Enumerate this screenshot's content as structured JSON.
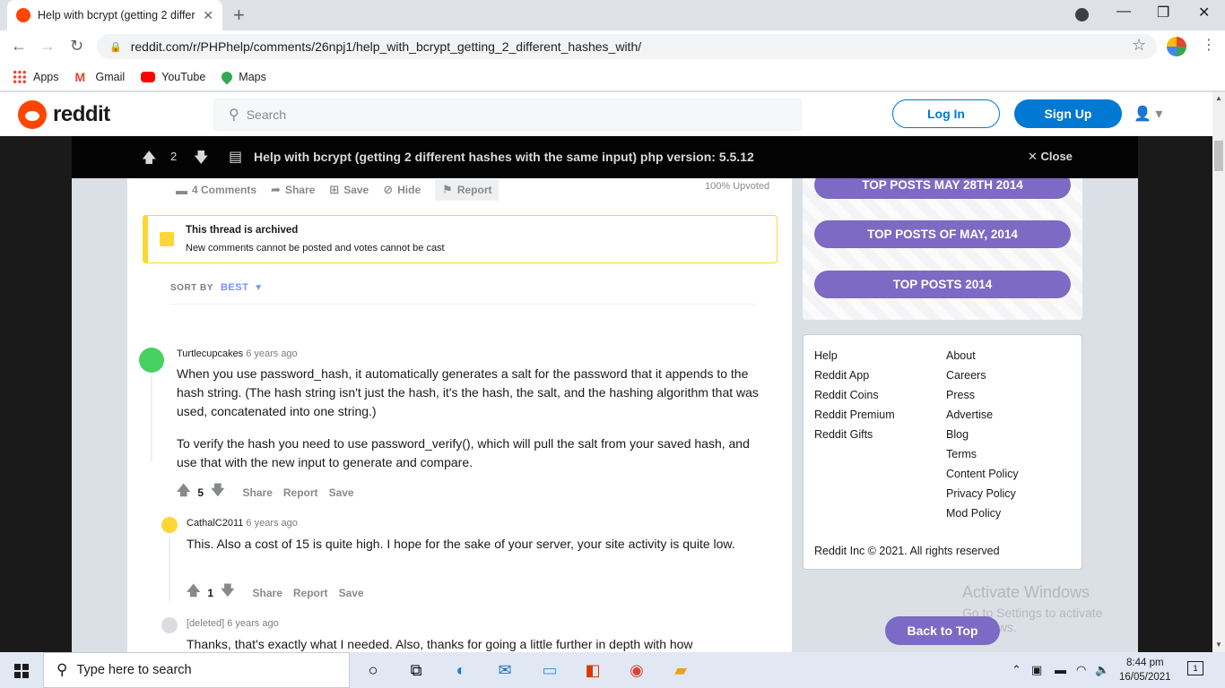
{
  "browser": {
    "tab_title": "Help with bcrypt (getting 2 differ",
    "url": "reddit.com/r/PHPhelp/comments/26npj1/help_with_bcrypt_getting_2_different_hashes_with/",
    "bookmarks": [
      "Apps",
      "Gmail",
      "YouTube",
      "Maps"
    ]
  },
  "header": {
    "logo_text": "reddit",
    "search_placeholder": "Search",
    "login_label": "Log In",
    "signup_label": "Sign Up"
  },
  "post": {
    "score": "2",
    "title": "Help with bcrypt (getting 2 different hashes with the same input) php version: 5.5.12",
    "close_label": "Close",
    "actions": {
      "comments": "4 Comments",
      "share": "Share",
      "save": "Save",
      "hide": "Hide",
      "report": "Report"
    },
    "upvoted": "100% Upvoted"
  },
  "archived": {
    "heading": "This thread is archived",
    "subtext": "New comments cannot be posted and votes cannot be cast"
  },
  "sort": {
    "label": "SORT BY",
    "value": "BEST"
  },
  "comments": [
    {
      "author": "Turtlecupcakes",
      "age": "6 years ago",
      "paragraphs": [
        "When you use password_hash, it automatically generates a salt for the password that it appends to the hash string. (The hash string isn't just the hash, it's the hash, the salt, and the hashing algorithm that was used, concatenated into one string.)",
        "To verify the hash you need to use password_verify(), which will pull the salt from your saved hash, and use that with the new input to generate and compare."
      ],
      "score": "5",
      "actions": [
        "Share",
        "Report",
        "Save"
      ]
    },
    {
      "author": "CathalC2011",
      "age": "6 years ago",
      "paragraphs": [
        "This. Also a cost of 15 is quite high. I hope for the sake of your server, your site activity is quite low."
      ],
      "score": "1",
      "actions": [
        "Share",
        "Report",
        "Save"
      ]
    },
    {
      "author": "[deleted]",
      "age": "6 years ago",
      "paragraphs": [
        "Thanks, that's exactly what I needed. Also, thanks for going a little further in depth with how"
      ]
    }
  ],
  "sidebar": {
    "top_posts": [
      "TOP POSTS MAY 28TH 2014",
      "TOP POSTS OF MAY, 2014",
      "TOP POSTS 2014"
    ],
    "links_left": [
      "Help",
      "Reddit App",
      "Reddit Coins",
      "Reddit Premium",
      "Reddit Gifts"
    ],
    "links_right": [
      "About",
      "Careers",
      "Press",
      "Advertise",
      "Blog",
      "Terms",
      "Content Policy",
      "Privacy Policy",
      "Mod Policy"
    ],
    "copyright": "Reddit Inc © 2021. All rights reserved",
    "back_to_top": "Back to Top"
  },
  "watermark": {
    "line1": "Activate Windows",
    "line2": "Go to Settings to activate Windows."
  },
  "taskbar": {
    "search_placeholder": "Type here to search",
    "time": "8:44 pm",
    "date": "16/05/2021",
    "notification_count": "1"
  }
}
